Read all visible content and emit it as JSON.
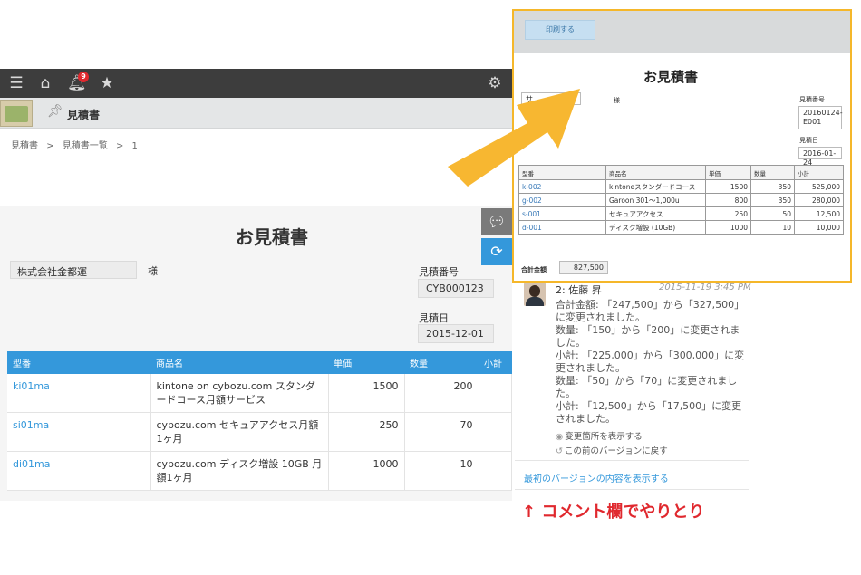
{
  "app": {
    "notification_count": "9",
    "title": "見積書",
    "breadcrumb": [
      "見積書",
      ">",
      "見積書一覧",
      ">",
      "1"
    ]
  },
  "record": {
    "doc_title": "お見積書",
    "customer": "株式会社金都運",
    "honorific": "様",
    "quote_no_label": "見積番号",
    "quote_no": "CYB000123",
    "quote_date_label": "見積日",
    "quote_date": "2015-12-01",
    "table": {
      "headers": [
        "型番",
        "商品名",
        "単価",
        "数量",
        "小計"
      ],
      "rows": [
        {
          "code": "ki01ma",
          "name": "kintone on cybozu.com スタンダードコース月額サービス",
          "price": "1500",
          "qty": "200"
        },
        {
          "code": "si01ma",
          "name": "cybozu.com セキュアアクセス月額1ヶ月",
          "price": "250",
          "qty": "70"
        },
        {
          "code": "di01ma",
          "name": "cybozu.com ディスク増設 10GB 月額1ヶ月",
          "price": "1000",
          "qty": "10"
        }
      ]
    }
  },
  "comment": {
    "author": "2: 佐藤 昇",
    "time": "2015-11-19 3:45 PM",
    "lines": [
      "合計金額: 「247,500」から「327,500」に変更されました。",
      "数量: 「150」から「200」に変更されました。",
      "小計: 「225,000」から「300,000」に変更されました。",
      "数量: 「50」から「70」に変更されました。",
      "小計: 「12,500」から「17,500」に変更されました。"
    ],
    "show_changes": "変更箇所を表示する",
    "revert": "この前のバージョンに戻す",
    "first_version": "最初のバージョンの内容を表示する"
  },
  "annotation": "↑ コメント欄でやりとり",
  "preview": {
    "print_button": "印刷する",
    "doc_title": "お見積書",
    "customer_partial": "サ",
    "customer_partial_tail": "式会社",
    "honorific": "様",
    "quote_no_label": "見積番号",
    "quote_no": "20160124-E001",
    "quote_date_label": "見積日",
    "quote_date": "2016-01-24",
    "table": {
      "headers": [
        "型番",
        "商品名",
        "単価",
        "数量",
        "小計"
      ],
      "rows": [
        {
          "code": "k-002",
          "name": "kintoneスタンダードコース",
          "price": "1500",
          "qty": "350",
          "subtotal": "525,000"
        },
        {
          "code": "g-002",
          "name": "Garoon 301～1,000u",
          "price": "800",
          "qty": "350",
          "subtotal": "280,000"
        },
        {
          "code": "s-001",
          "name": "セキュアアクセス",
          "price": "250",
          "qty": "50",
          "subtotal": "12,500"
        },
        {
          "code": "d-001",
          "name": "ディスク増設 (10GB)",
          "price": "1000",
          "qty": "10",
          "subtotal": "10,000"
        }
      ]
    },
    "total_label": "合計金額",
    "total": "827,500"
  },
  "colors": {
    "accent": "#3498db",
    "highlight_border": "#f5b72a",
    "arrow": "#f7b731",
    "annotation": "#e0282e"
  }
}
